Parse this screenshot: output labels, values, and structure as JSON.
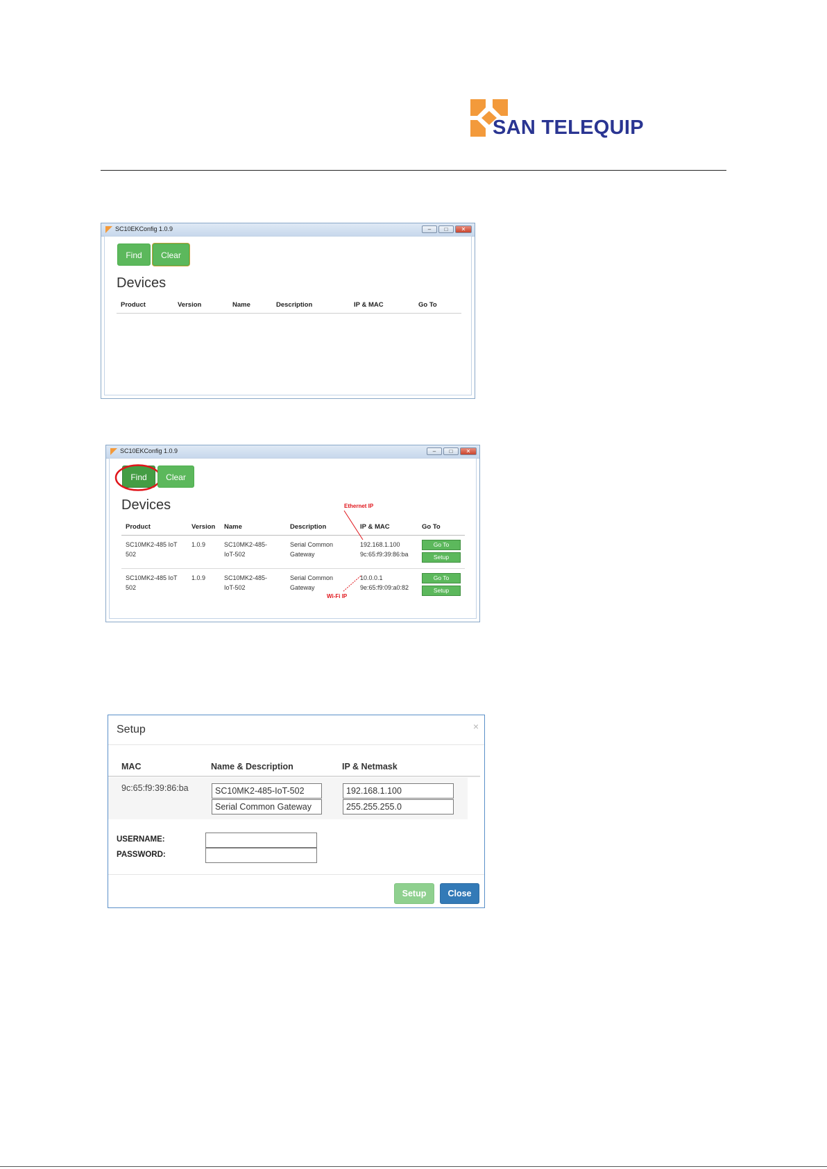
{
  "header": {
    "logo_text": "SAN TELEQUIP",
    "logo_colors": {
      "square": "#f39a3b",
      "text": "#2a3592"
    }
  },
  "screenshot1": {
    "window_title": "SC10EKConfig 1.0.9",
    "buttons": {
      "find": "Find",
      "clear": "Clear"
    },
    "heading": "Devices",
    "columns": [
      "Product",
      "Version",
      "Name",
      "Description",
      "IP & MAC",
      "Go To"
    ]
  },
  "screenshot2": {
    "window_title": "SC10EKConfig 1.0.9",
    "buttons": {
      "find": "Find",
      "clear": "Clear"
    },
    "heading": "Devices",
    "columns": [
      "Product",
      "Version",
      "Name",
      "Description",
      "IP & MAC",
      "Go To"
    ],
    "rows": [
      {
        "product": [
          "SC10MK2-485 IoT",
          "502"
        ],
        "version": "1.0.9",
        "name": [
          "SC10MK2-485-",
          "IoT-502"
        ],
        "description": [
          "Serial Common",
          "Gateway"
        ],
        "ip_mac": [
          "192.168.1.100",
          "9c:65:f9:39:86:ba"
        ],
        "goto_label": "Go To",
        "setup_label": "Setup"
      },
      {
        "product": [
          "SC10MK2-485 IoT",
          "502"
        ],
        "version": "1.0.9",
        "name": [
          "SC10MK2-485-",
          "IoT-502"
        ],
        "description": [
          "Serial Common",
          "Gateway"
        ],
        "ip_mac": [
          "10.0.0.1",
          "9e:65:f9:09:a0:82"
        ],
        "goto_label": "Go To",
        "setup_label": "Setup"
      }
    ],
    "annotations": {
      "ethernet": "Ethernet IP",
      "wifi": "Wi-Fi IP"
    }
  },
  "setup_dialog": {
    "title": "Setup",
    "close_x": "×",
    "columns": {
      "mac": "MAC",
      "name_desc": "Name & Description",
      "ip_netmask": "IP & Netmask"
    },
    "mac": "9c:65:f9:39:86:ba",
    "name_value": "SC10MK2-485-IoT-502",
    "description_value": "Serial Common Gateway",
    "ip_value": "192.168.1.100",
    "netmask_value": "255.255.255.0",
    "username_label": "USERNAME:",
    "password_label": "PASSWORD:",
    "username_value": "",
    "password_value": "",
    "setup_button": "Setup",
    "close_button": "Close"
  }
}
